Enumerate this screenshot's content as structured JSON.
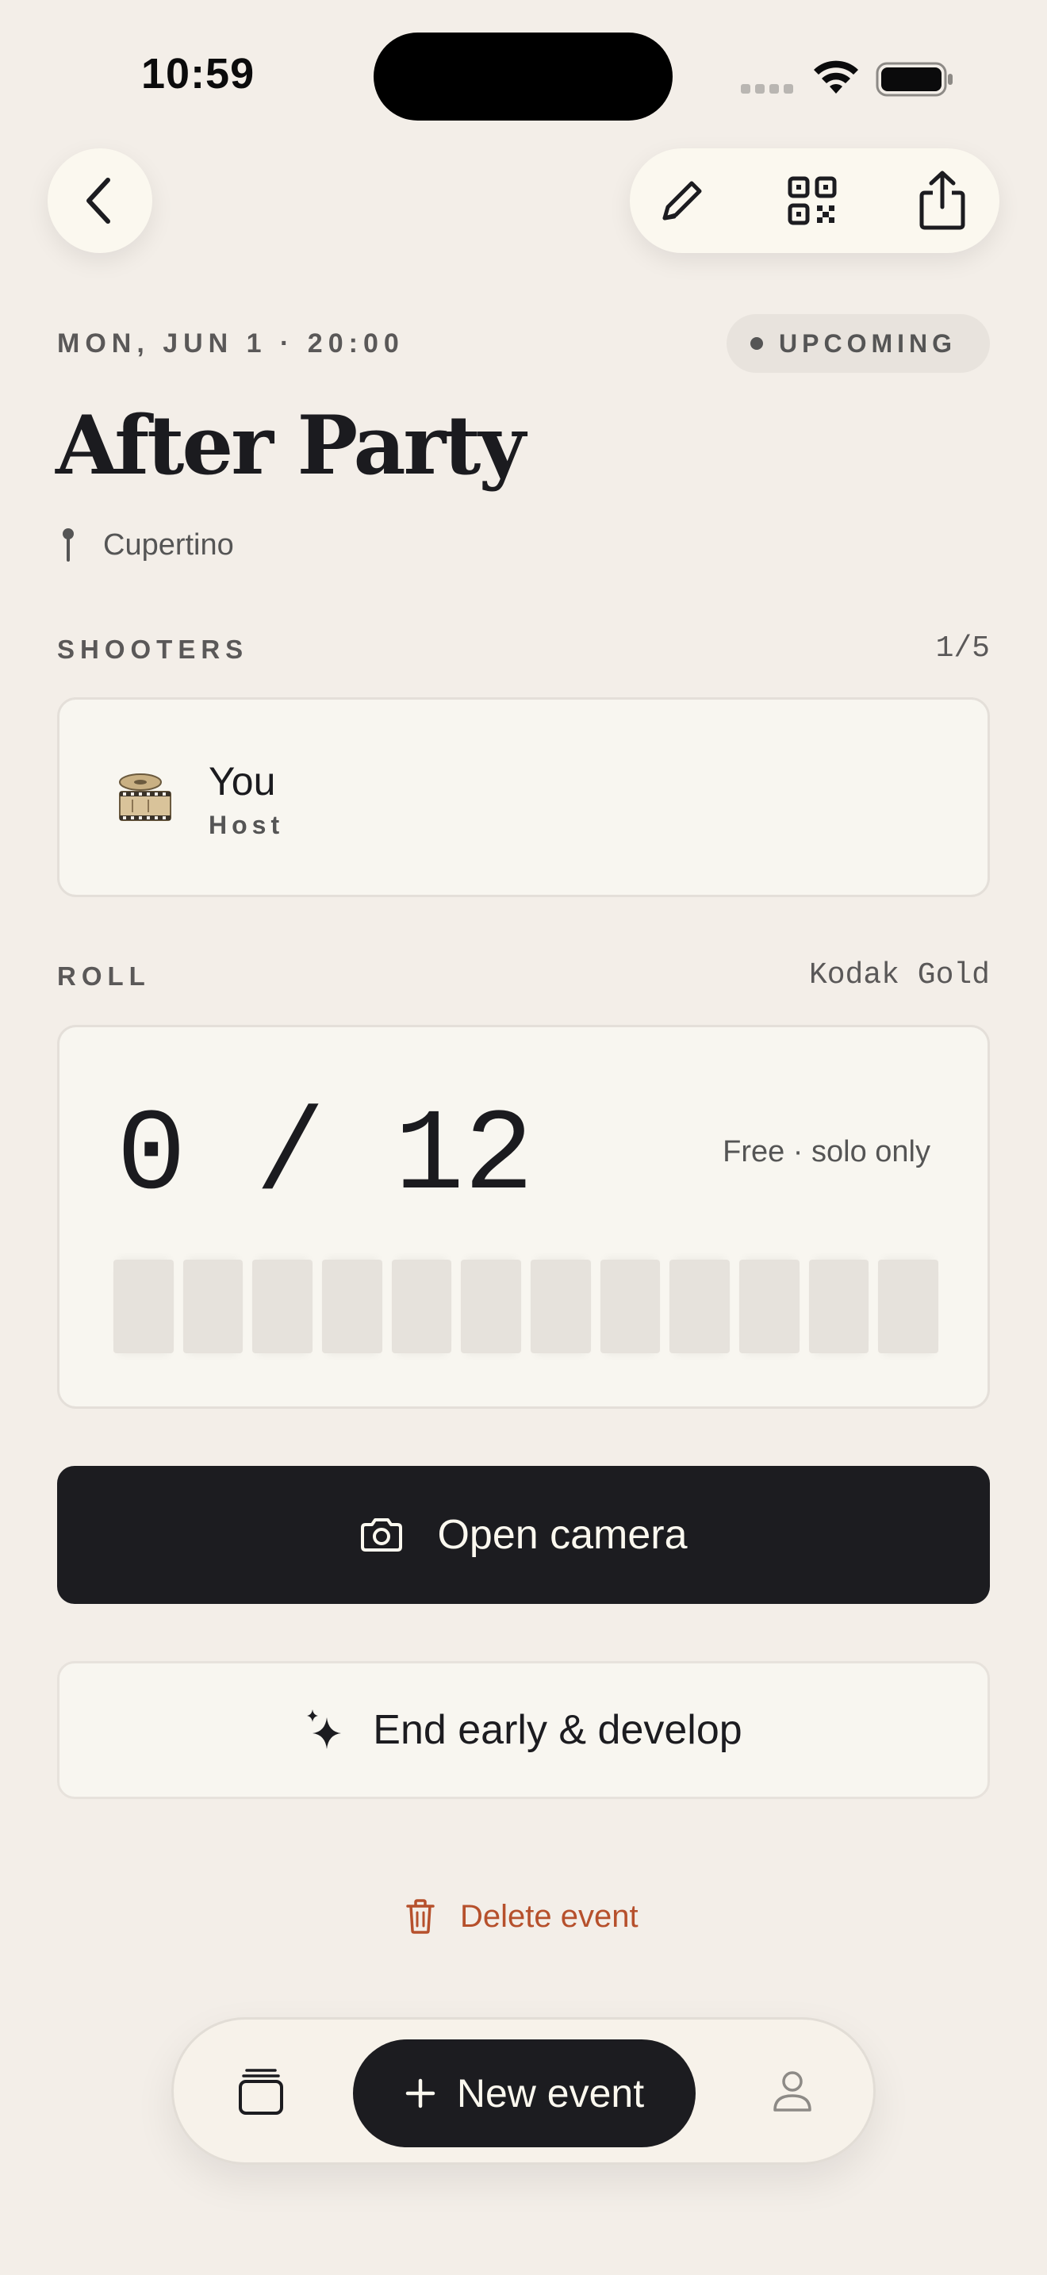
{
  "status_bar": {
    "time": "10:59"
  },
  "event": {
    "date_time": "MON, JUN 1 · 20:00",
    "status": "UPCOMING",
    "title": "After Party",
    "location": "Cupertino"
  },
  "shooters": {
    "label": "SHOOTERS",
    "count": "1/5",
    "items": [
      {
        "name": "You",
        "role": "Host",
        "avatar_icon": "film-reel-icon"
      }
    ]
  },
  "roll": {
    "label": "ROLL",
    "film": "Kodak Gold",
    "count": "0 / 12",
    "note": "Free · solo only",
    "frames_used": 0,
    "frames_total": 12
  },
  "actions": {
    "open_camera": "Open camera",
    "end_early": "End early & develop",
    "delete": "Delete event"
  },
  "tab_bar": {
    "new_event": "New event"
  },
  "colors": {
    "background": "#f3eee8",
    "primary": "#1c1c20",
    "danger": "#b6502c",
    "card": "#f8f6f0"
  }
}
